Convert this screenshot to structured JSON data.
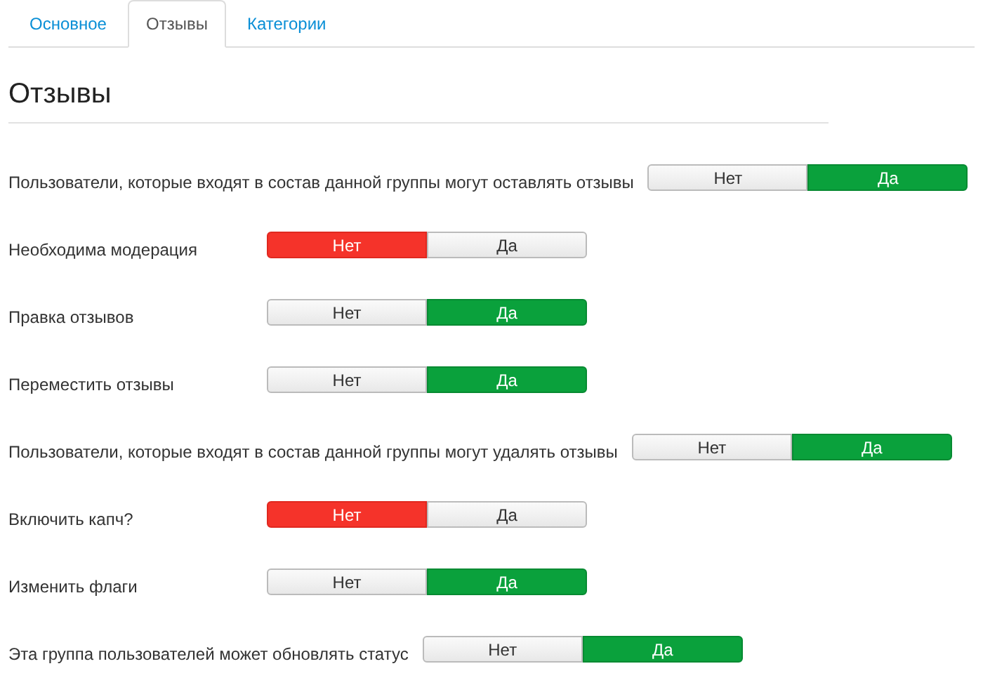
{
  "tabs": [
    {
      "label": "Основное",
      "selected": false
    },
    {
      "label": "Отзывы",
      "selected": true
    },
    {
      "label": "Категории",
      "selected": false
    }
  ],
  "heading": "Отзывы",
  "settings": [
    {
      "label": "Пользователи, которые входят в состав данной группы могут оставлять отзывы",
      "options": [
        {
          "label": "Нет",
          "selected": false
        },
        {
          "label": "Да",
          "selected": true
        }
      ]
    },
    {
      "label": "Необходима модерация",
      "options": [
        {
          "label": "Нет",
          "selected": true
        },
        {
          "label": "Да",
          "selected": false
        }
      ]
    },
    {
      "label": "Правка отзывов",
      "options": [
        {
          "label": "Нет",
          "selected": false
        },
        {
          "label": "Да",
          "selected": true
        }
      ]
    },
    {
      "label": "Переместить отзывы",
      "options": [
        {
          "label": "Нет",
          "selected": false
        },
        {
          "label": "Да",
          "selected": true
        }
      ]
    },
    {
      "label": "Пользователи, которые входят в состав данной группы могут удалять отзывы",
      "options": [
        {
          "label": "Нет",
          "selected": false
        },
        {
          "label": "Да",
          "selected": true
        }
      ]
    },
    {
      "label": "Включить капч?",
      "options": [
        {
          "label": "Нет",
          "selected": true
        },
        {
          "label": "Да",
          "selected": false
        }
      ]
    },
    {
      "label": "Изменить флаги",
      "options": [
        {
          "label": "Нет",
          "selected": false
        },
        {
          "label": "Да",
          "selected": true
        }
      ]
    },
    {
      "label": "Эта группа пользователей может обновлять статус",
      "options": [
        {
          "label": "Нет",
          "selected": false
        },
        {
          "label": "Да",
          "selected": true
        }
      ]
    }
  ]
}
